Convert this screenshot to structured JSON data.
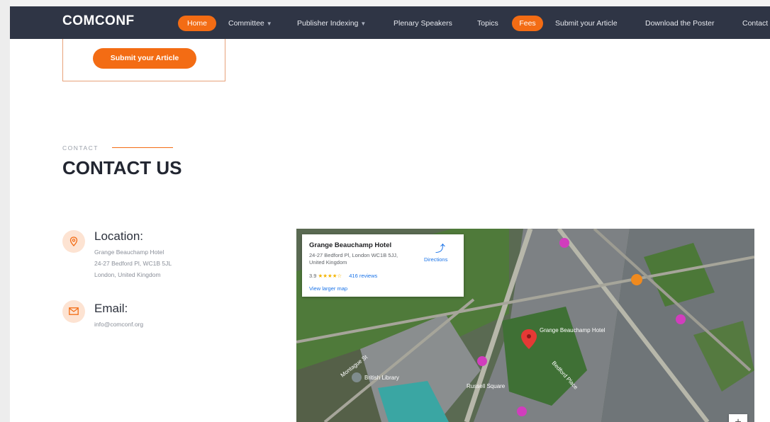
{
  "nav": {
    "brand": "COMCONF",
    "items": [
      {
        "label": "Home",
        "dropdown": false,
        "highlight": true
      },
      {
        "label": "Committee",
        "dropdown": true,
        "highlight": false
      },
      {
        "label": "Publisher Indexing",
        "dropdown": true,
        "highlight": false
      },
      {
        "label": "Plenary Speakers",
        "dropdown": false,
        "highlight": false
      },
      {
        "label": "Topics",
        "dropdown": false,
        "highlight": false
      },
      {
        "label": "Fees",
        "dropdown": false,
        "highlight": true
      },
      {
        "label": "Submit your Article",
        "dropdown": false,
        "highlight": false
      },
      {
        "label": "Download the Poster",
        "dropdown": false,
        "highlight": false
      },
      {
        "label": "Contact",
        "dropdown": false,
        "highlight": false
      }
    ]
  },
  "submit": {
    "button_label": "Submit your Article"
  },
  "contact": {
    "eyebrow": "CONTACT",
    "title": "CONTACT US",
    "location": {
      "heading": "Location:",
      "lines": [
        "Grange Beauchamp Hotel",
        "24-27 Bedford Pl, WC1B 5JL",
        "London, United Kingdom"
      ]
    },
    "email": {
      "heading": "Email:",
      "value": "info@comconf.org"
    }
  },
  "map": {
    "card": {
      "title": "Grange Beauchamp Hotel",
      "address_lines": [
        "24-27 Bedford Pl, London WC1B 5JJ,",
        "United Kingdom"
      ],
      "rating": "3.9",
      "stars": "★★★★☆",
      "reviews": "416 reviews",
      "directions": "Directions",
      "larger_map": "View larger map"
    },
    "labels": [
      "Grange Beauchamp Hotel",
      "Bedford Place",
      "Montague St",
      "Russell Square",
      "British Library"
    ],
    "zoom_in": "+"
  },
  "colors": {
    "accent": "#f36c14",
    "nav_bg": "#2f3545",
    "title": "#222631"
  }
}
